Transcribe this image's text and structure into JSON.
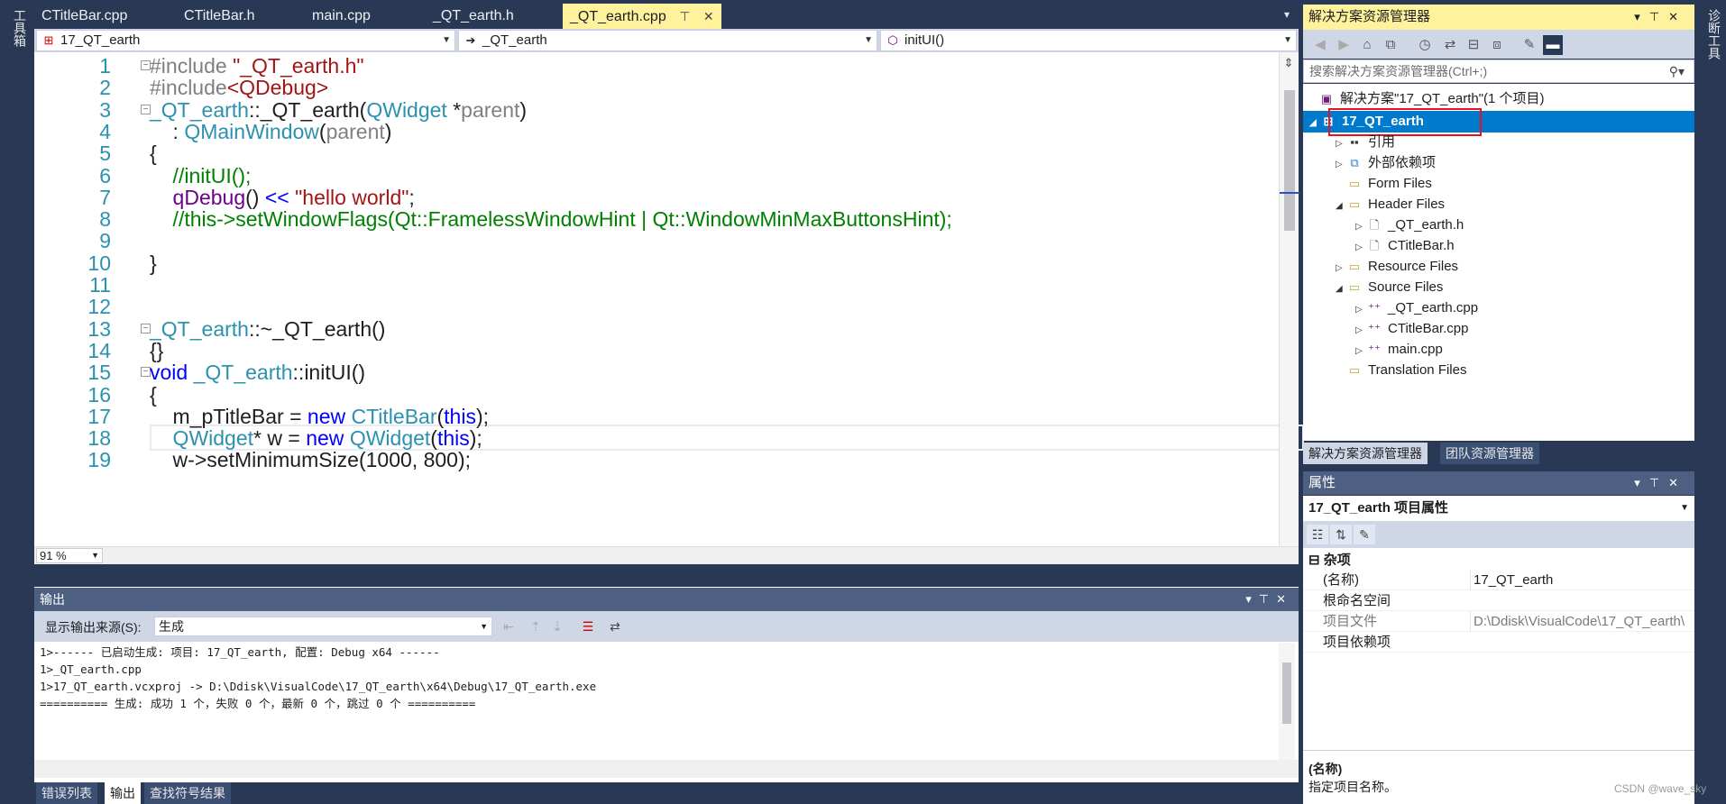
{
  "toolbox": {
    "left_label": "工具箱",
    "right_label": "诊断工具"
  },
  "tabs": [
    {
      "label": "CTitleBar.cpp"
    },
    {
      "label": "CTitleBar.h"
    },
    {
      "label": "main.cpp"
    },
    {
      "label": "_QT_earth.h"
    },
    {
      "label": "_QT_earth.cpp",
      "active": true
    }
  ],
  "tab_controls": {
    "pin": "⊤",
    "close": "✕",
    "overflow": "▾"
  },
  "navbar": {
    "project": "17_QT_earth",
    "scope": "_QT_earth",
    "member": "initUI()"
  },
  "editor": {
    "zoom": "91 %",
    "lines": [
      {
        "n": "1",
        "tokens": [
          [
            "pre",
            "#include "
          ],
          [
            "str",
            "\"_QT_earth.h\""
          ]
        ]
      },
      {
        "n": "2",
        "tokens": [
          [
            "pre",
            "#include"
          ],
          [
            "str",
            "<QDebug>"
          ]
        ]
      },
      {
        "n": "3",
        "tokens": [
          [
            "type",
            "_QT_earth"
          ],
          [
            "plain",
            "::_QT_earth("
          ],
          [
            "type",
            "QWidget"
          ],
          [
            "plain",
            " *"
          ],
          [
            "param",
            "parent"
          ],
          [
            "plain",
            ")"
          ]
        ]
      },
      {
        "n": "4",
        "tokens": [
          [
            "plain",
            "    : "
          ],
          [
            "type",
            "QMainWindow"
          ],
          [
            "plain",
            "("
          ],
          [
            "param",
            "parent"
          ],
          [
            "plain",
            ")"
          ]
        ]
      },
      {
        "n": "5",
        "tokens": [
          [
            "plain",
            "{"
          ]
        ]
      },
      {
        "n": "6",
        "tokens": [
          [
            "com",
            "    //initUI();"
          ]
        ]
      },
      {
        "n": "7",
        "tokens": [
          [
            "macro",
            "    qDebug"
          ],
          [
            "plain",
            "() "
          ],
          [
            "kw",
            "<<"
          ],
          [
            "plain",
            " "
          ],
          [
            "str",
            "\"hello world\""
          ],
          [
            "plain",
            ";"
          ]
        ]
      },
      {
        "n": "8",
        "tokens": [
          [
            "com",
            "    //this->setWindowFlags(Qt::FramelessWindowHint | Qt::WindowMinMaxButtonsHint);"
          ]
        ]
      },
      {
        "n": "9",
        "tokens": []
      },
      {
        "n": "10",
        "tokens": [
          [
            "plain",
            "}"
          ]
        ]
      },
      {
        "n": "11",
        "tokens": []
      },
      {
        "n": "12",
        "tokens": []
      },
      {
        "n": "13",
        "tokens": [
          [
            "type",
            "_QT_earth"
          ],
          [
            "plain",
            "::~_QT_earth()"
          ]
        ]
      },
      {
        "n": "14",
        "tokens": [
          [
            "plain",
            "{}"
          ]
        ]
      },
      {
        "n": "15",
        "tokens": [
          [
            "kw",
            "void"
          ],
          [
            "plain",
            " "
          ],
          [
            "type",
            "_QT_earth"
          ],
          [
            "plain",
            "::initUI()"
          ]
        ]
      },
      {
        "n": "16",
        "tokens": [
          [
            "plain",
            "{"
          ]
        ]
      },
      {
        "n": "17",
        "tokens": [
          [
            "plain",
            "    m_pTitleBar = "
          ],
          [
            "kw",
            "new"
          ],
          [
            "plain",
            " "
          ],
          [
            "type",
            "CTitleBar"
          ],
          [
            "plain",
            "("
          ],
          [
            "kw",
            "this"
          ],
          [
            "plain",
            ");"
          ]
        ]
      },
      {
        "n": "18",
        "tokens": [
          [
            "type",
            "    QWidget"
          ],
          [
            "plain",
            "* w = "
          ],
          [
            "kw",
            "new"
          ],
          [
            "plain",
            " "
          ],
          [
            "type",
            "QWidget"
          ],
          [
            "plain",
            "("
          ],
          [
            "kw",
            "this"
          ],
          [
            "plain",
            ");"
          ]
        ]
      },
      {
        "n": "19",
        "tokens": [
          [
            "plain",
            "    w->setMinimumSize(1000, 800);"
          ]
        ]
      }
    ]
  },
  "output": {
    "title": "输出",
    "source_label": "显示输出来源(S):",
    "source_value": "生成",
    "lines": [
      "1>------ 已启动生成: 项目: 17_QT_earth, 配置: Debug x64 ------",
      "1>_QT_earth.cpp",
      "1>17_QT_earth.vcxproj -> D:\\Ddisk\\VisualCode\\17_QT_earth\\x64\\Debug\\17_QT_earth.exe",
      "========== 生成: 成功 1 个，失败 0 个，最新 0 个，跳过 0 个 =========="
    ],
    "bottom_tabs": [
      "错误列表",
      "输出",
      "查找符号结果"
    ]
  },
  "solution_explorer": {
    "title": "解决方案资源管理器",
    "search_placeholder": "搜索解决方案资源管理器(Ctrl+;)",
    "solution": "解决方案\"17_QT_earth\"(1 个项目)",
    "project": "17_QT_earth",
    "nodes": [
      {
        "label": "引用",
        "icon": "references-icon"
      },
      {
        "label": "外部依赖项",
        "icon": "external-deps-icon"
      },
      {
        "label": "Form Files",
        "icon": "folder-icon"
      },
      {
        "label": "Header Files",
        "icon": "folder-icon"
      },
      {
        "label": "_QT_earth.h",
        "icon": "header-file-icon"
      },
      {
        "label": "CTitleBar.h",
        "icon": "header-file-icon"
      },
      {
        "label": "Resource Files",
        "icon": "folder-icon"
      },
      {
        "label": "Source Files",
        "icon": "folder-icon"
      },
      {
        "label": "_QT_earth.cpp",
        "icon": "cpp-file-icon"
      },
      {
        "label": "CTitleBar.cpp",
        "icon": "cpp-file-icon"
      },
      {
        "label": "main.cpp",
        "icon": "cpp-file-icon"
      },
      {
        "label": "Translation Files",
        "icon": "folder-icon"
      }
    ],
    "tabs": [
      "解决方案资源管理器",
      "团队资源管理器"
    ]
  },
  "properties": {
    "title": "属性",
    "object": "17_QT_earth 项目属性",
    "category": "杂项",
    "rows": [
      {
        "key": "(名称)",
        "value": "17_QT_earth",
        "dim": false
      },
      {
        "key": "根命名空间",
        "value": "",
        "dim": false
      },
      {
        "key": "项目文件",
        "value": "D:\\Ddisk\\VisualCode\\17_QT_earth\\",
        "dim": true
      },
      {
        "key": "项目依赖项",
        "value": "",
        "dim": false
      }
    ],
    "desc_title": "(名称)",
    "desc_text": "指定项目名称。"
  },
  "watermark": "CSDN @wave_sky",
  "colors": {
    "accent_tab": "#fff29d",
    "selection": "#007acc",
    "frame": "#293955",
    "highlight_box": "#e81123"
  }
}
